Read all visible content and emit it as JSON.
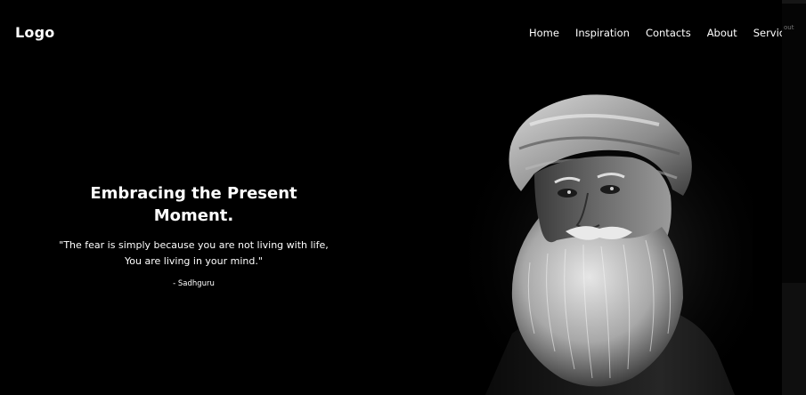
{
  "header": {
    "logo": "Logo",
    "nav": [
      "Home",
      "Inspiration",
      "Contacts",
      "About",
      "Services"
    ]
  },
  "hero": {
    "title": "Embracing the Present\nMoment.",
    "quote": "\"The fear is simply because you are not living with life,\nYou are living in your mind.\"",
    "author": "- Sadhguru"
  },
  "edge": {
    "ghost_text": "out"
  },
  "colors": {
    "background": "#000000",
    "text": "#ffffff"
  }
}
